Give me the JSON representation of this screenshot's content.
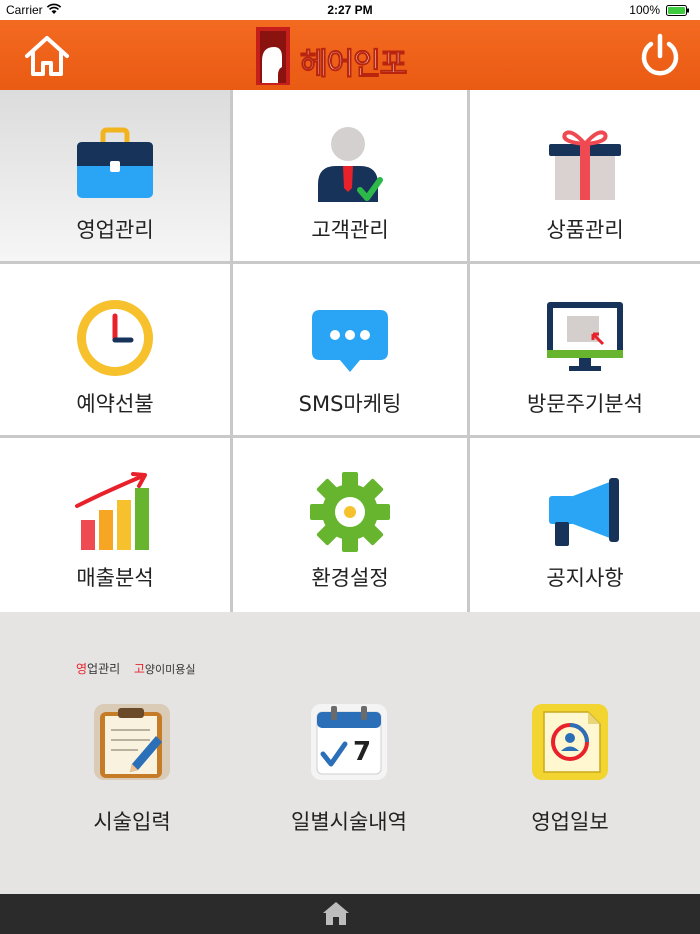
{
  "status_bar": {
    "carrier": "Carrier",
    "time": "2:27 PM",
    "battery": "100%"
  },
  "header": {
    "logo_text": "헤어인포",
    "home_icon": "home-icon",
    "power_icon": "power-icon"
  },
  "menu": [
    {
      "label": "영업관리",
      "icon": "briefcase-icon"
    },
    {
      "label": "고객관리",
      "icon": "customer-icon"
    },
    {
      "label": "상품관리",
      "icon": "gift-box-icon"
    },
    {
      "label": "예약선불",
      "icon": "clock-icon"
    },
    {
      "label": "SMS마케팅",
      "icon": "chat-bubble-icon"
    },
    {
      "label": "방문주기분석",
      "icon": "monitor-icon"
    },
    {
      "label": "매출분석",
      "icon": "bar-chart-icon"
    },
    {
      "label": "환경설정",
      "icon": "gear-icon"
    },
    {
      "label": "공지사항",
      "icon": "megaphone-icon"
    }
  ],
  "caption": {
    "part1_first": "영",
    "part1_rest": "업관리",
    "part2_first": "고",
    "part2_rest": "양이미용실"
  },
  "sub_menu": [
    {
      "label": "시술입력",
      "icon": "clipboard-icon"
    },
    {
      "label": "일별시술내역",
      "icon": "calendar-icon"
    },
    {
      "label": "영업일보",
      "icon": "report-icon"
    }
  ],
  "colors": {
    "header": "#f36a21",
    "accent_red": "#e8212a",
    "bottom_bar": "#2b2b2b"
  }
}
